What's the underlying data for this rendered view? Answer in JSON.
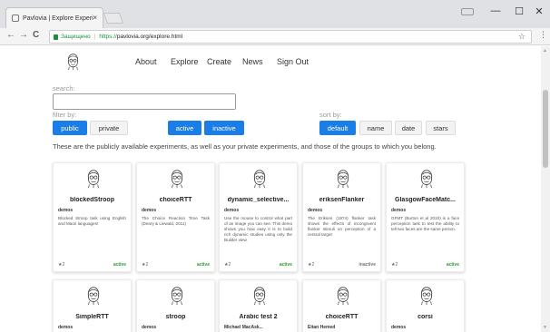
{
  "browser": {
    "tab_title": "Pavlovia | Explore Experi",
    "tab_close": "×",
    "window_controls": {
      "minimize": "—",
      "maximize": "☐",
      "close": "✕"
    },
    "back": "←",
    "forward": "→",
    "reload": "C",
    "secure_label": "Защищено",
    "url_proto": "https://",
    "url_rest": "pavlovia.org/explore.html",
    "star": "☆",
    "menu": "⋮"
  },
  "nav": {
    "about": "About",
    "explore": "Explore",
    "create": "Create",
    "news": "News",
    "signout": "Sign Out"
  },
  "search": {
    "label": "search:",
    "value": ""
  },
  "filter": {
    "label": "filter by:",
    "public": "public",
    "private": "private",
    "active": "active",
    "inactive": "inactive"
  },
  "sort": {
    "label": "sort by:",
    "default": "default",
    "name": "name",
    "date": "date",
    "stars": "stars"
  },
  "intro": "These are the publicly available experiments, as well as your private experiments, and those of the groups to which you belong.",
  "colors": {
    "accent": "#1a7ee6",
    "active": "#2e9c2e",
    "inactive": "#777777"
  },
  "cards": [
    {
      "title": "blockedStroop",
      "owner": "demos",
      "desc": "Blocked Stroop task using English and Maori languages!",
      "stars": "★2",
      "status": "active"
    },
    {
      "title": "choiceRTT",
      "owner": "demos",
      "desc": "The Choice Reaction Time Task (Deary & Liewald, 2011)",
      "stars": "★2",
      "status": "active"
    },
    {
      "title": "dynamic_selective...",
      "owner": "demos",
      "desc": "Use the mouse to control what part of an image you can see. This demo shows you how easy it is to build rich dynamic studies using only the Builder view.",
      "stars": "★2",
      "status": "active"
    },
    {
      "title": "eriksenFlanker",
      "owner": "demos",
      "desc": "The Eriksen (1974) flanker task shows the effects of incongruent flanker stimuli on perception of a central target",
      "stars": "★2",
      "status": "inactive"
    },
    {
      "title": "GlasgowFaceMatc...",
      "owner": "demos",
      "desc": "GFMT (Burton et al 2010) is a face perception task to test the ability to tell two faces are the same person.",
      "stars": "★2",
      "status": "active"
    },
    {
      "title": "SimpleRTT",
      "owner": "demos"
    },
    {
      "title": "stroop",
      "owner": "demos"
    },
    {
      "title": "Arabic test 2",
      "owner": "Michael MacAsk..."
    },
    {
      "title": "choiceRTT",
      "owner": "Eitan Hemed"
    },
    {
      "title": "corsi",
      "owner": "demos"
    }
  ]
}
